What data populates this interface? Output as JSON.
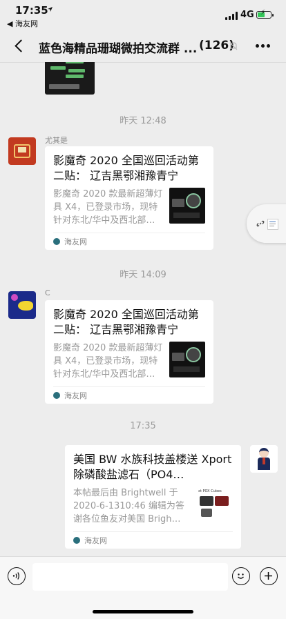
{
  "status_bar": {
    "time": "17:35",
    "back_app": "◀ 海友网",
    "network": "4G",
    "battery_level": 0.6
  },
  "nav": {
    "title": "蓝色海精品珊瑚微拍交流群 ...",
    "member_count": "(126)"
  },
  "messages": [
    {
      "timestamp": "昨天 12:48",
      "sender": "尤其是",
      "card": {
        "title": "影魔奇 2020 全国巡回活动第二贴： 辽吉黑鄂湘豫青宁",
        "description": "影魔奇 2020 款最新超薄灯具 X4，已登录市场，现特针对东北/华中及西北部…",
        "source": "海友网"
      }
    },
    {
      "timestamp": "昨天 14:09",
      "sender": "C",
      "card": {
        "title": "影魔奇 2020 全国巡回活动第二贴： 辽吉黑鄂湘豫青宁",
        "description": "影魔奇 2020 款最新超薄灯具 X4，已登录市场，现特针对东北/华中及西北部…",
        "source": "海友网"
      }
    },
    {
      "timestamp": "17:35",
      "sender": "",
      "card": {
        "title": "美国 BW 水族科技盖楼送 Xport 除磷酸盐滤石（PO4…",
        "description": "本帖最后由 Brightwell 于 2020-6-1310:46 编辑为答谢各位鱼友对美国 Brigh…",
        "thumb_label": "xt POX Cubes",
        "source": "海友网"
      }
    }
  ],
  "colors": {
    "background": "#ededed",
    "card": "#ffffff",
    "battery": "#34c759"
  }
}
